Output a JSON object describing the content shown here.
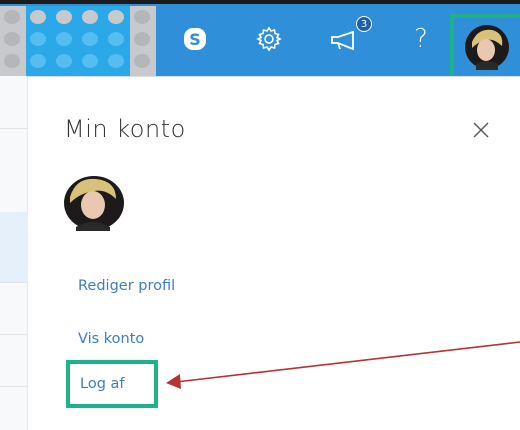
{
  "topbar": {
    "accent": "#2f8fd8",
    "icons": [
      "skype-icon",
      "gear-icon",
      "megaphone-icon",
      "help-icon",
      "avatar"
    ],
    "notification_count": "3",
    "help_glyph": "?"
  },
  "panel": {
    "title": "Min konto",
    "close_glyph": "×",
    "links": {
      "edit_profile": "Rediger profil",
      "view_account": "Vis konto",
      "sign_out": "Log af"
    },
    "link_color": "#3a7dc9",
    "highlight_color": "#1db28a",
    "arrow_color": "#b83232"
  }
}
